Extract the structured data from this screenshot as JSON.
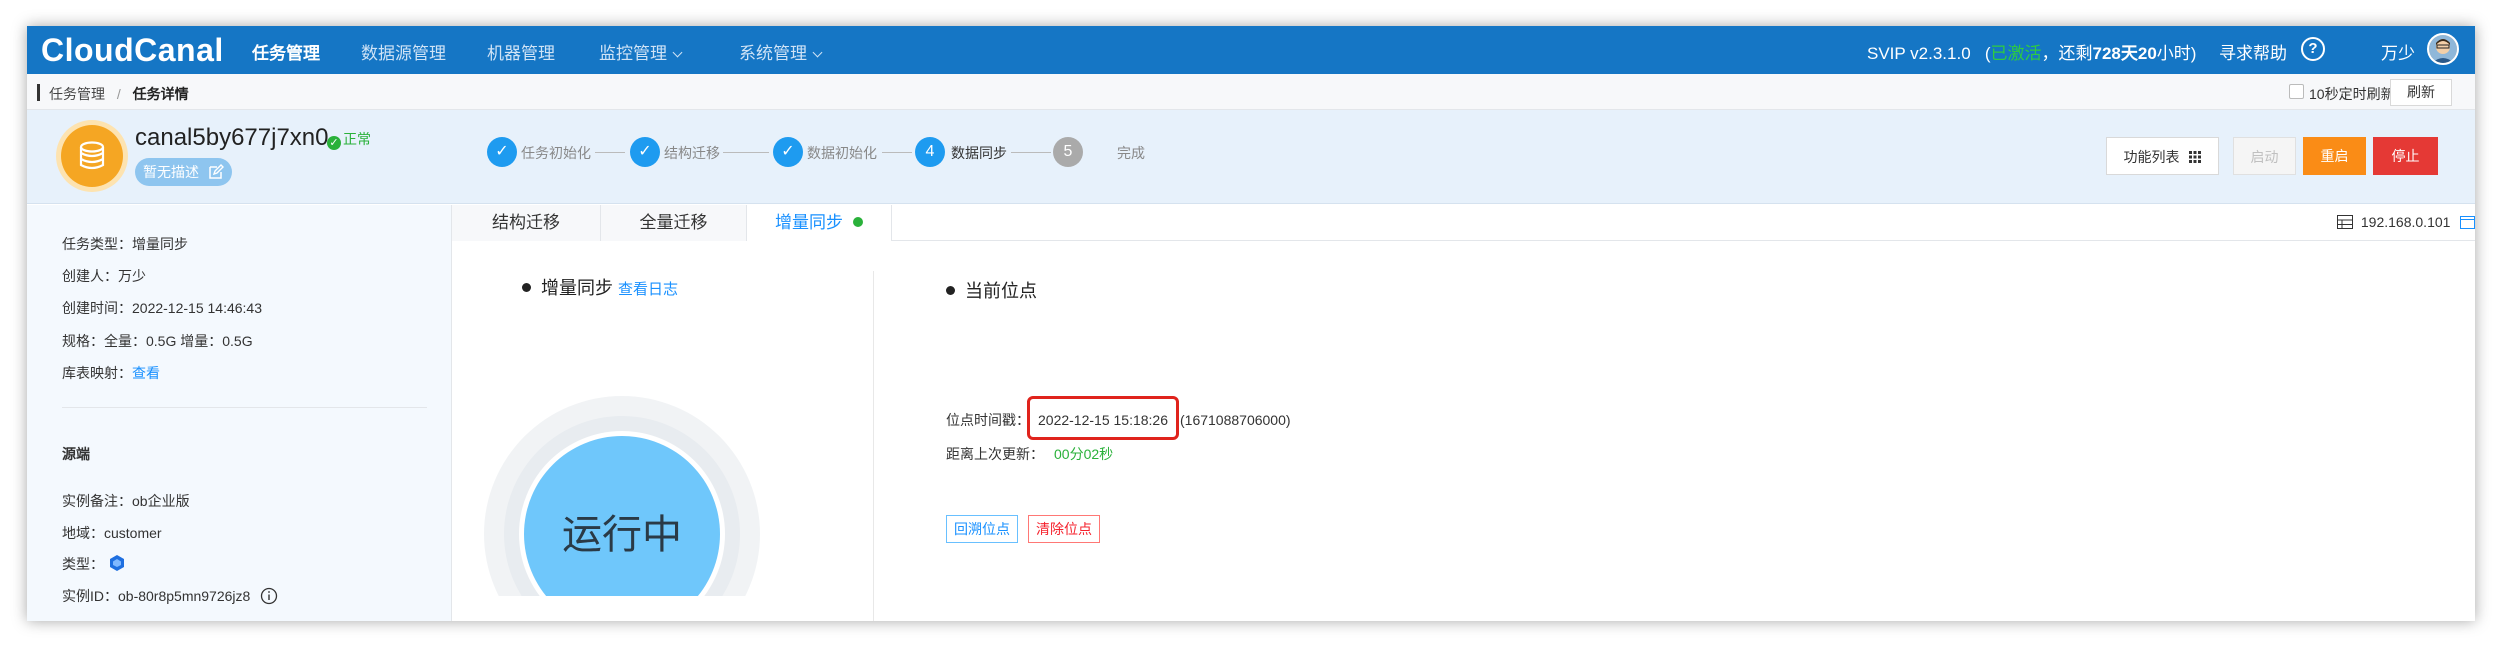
{
  "nav": {
    "logo": "CloudCanal",
    "items": [
      {
        "label": "任务管理",
        "active": true
      },
      {
        "label": "数据源管理",
        "active": false
      },
      {
        "label": "机器管理",
        "active": false
      },
      {
        "label": "监控管理",
        "active": false,
        "dropdown": true
      },
      {
        "label": "系统管理",
        "active": false,
        "dropdown": true
      }
    ],
    "version": "SVIP v2.3.1.0",
    "activated": "已激活",
    "remaining_prefix": "，还剩",
    "remaining_days": "728",
    "remaining_mid": "天",
    "remaining_hours": "20",
    "remaining_suffix": "小时)",
    "help": "寻求帮助",
    "help_icon": "?",
    "user": "万少",
    "colors": {
      "bar": "#1576c5",
      "active_green": "#2ecc40"
    }
  },
  "breadcrumb": {
    "parent": "任务管理",
    "separator": "/",
    "current": "任务详情",
    "auto_refresh_label": "10秒定时刷新",
    "refresh_button": "刷新"
  },
  "task": {
    "name": "canal5by677j7xn0",
    "status": "正常",
    "description": "暂无描述",
    "steps": [
      {
        "num": "1",
        "label": "任务初始化",
        "state": "done"
      },
      {
        "num": "2",
        "label": "结构迁移",
        "state": "done"
      },
      {
        "num": "3",
        "label": "数据初始化",
        "state": "done"
      },
      {
        "num": "4",
        "label": "数据同步",
        "state": "current"
      },
      {
        "num": "5",
        "label": "完成",
        "state": "todo"
      }
    ],
    "buttons": {
      "functions": "功能列表",
      "start": "启动",
      "restart": "重启",
      "stop": "停止"
    },
    "colors": {
      "restart": "#fa8c16",
      "stop": "#e53935",
      "step": "#1e9bf0"
    }
  },
  "info": {
    "type_label": "任务类型：",
    "type_value": "增量同步",
    "creator_label": "创建人：",
    "creator_value": "万少",
    "created_label": "创建时间：",
    "created_value": "2022-12-15 14:46:43",
    "spec_label": "规格：",
    "spec_value": "全量：0.5G 增量：0.5G",
    "mapping_label": "库表映射：",
    "mapping_link": "查看",
    "source_section": "源端",
    "remark_label": "实例备注：",
    "remark_value": "ob企业版",
    "region_label": "地域：",
    "region_value": "customer",
    "kind_label": "类型：",
    "instance_label": "实例ID：",
    "instance_value": "ob-80r8p5mn9726jz8"
  },
  "tabs": [
    {
      "label": "结构迁移",
      "active": false
    },
    {
      "label": "全量迁移",
      "active": false
    },
    {
      "label": "增量同步",
      "active": true
    }
  ],
  "host_ip": "192.168.0.101",
  "incremental": {
    "title": "增量同步",
    "log_link": "查看日志",
    "state_text": "运行中"
  },
  "position": {
    "title": "当前位点",
    "time_label": "位点时间戳：",
    "time_value": "2022-12-15 15:18:26",
    "epoch": "(1671088706000)",
    "since_label": "距离上次更新：",
    "since_value": "00分02秒",
    "rewind_button": "回溯位点",
    "clear_button": "清除位点"
  }
}
